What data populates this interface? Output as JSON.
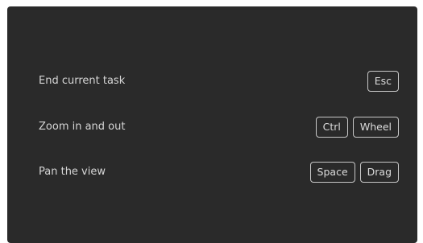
{
  "shortcuts": [
    {
      "action": "End current task",
      "keys": [
        "Esc"
      ]
    },
    {
      "action": "Zoom in and out",
      "keys": [
        "Ctrl",
        "Wheel"
      ]
    },
    {
      "action": "Pan the view",
      "keys": [
        "Space",
        "Drag"
      ]
    }
  ]
}
